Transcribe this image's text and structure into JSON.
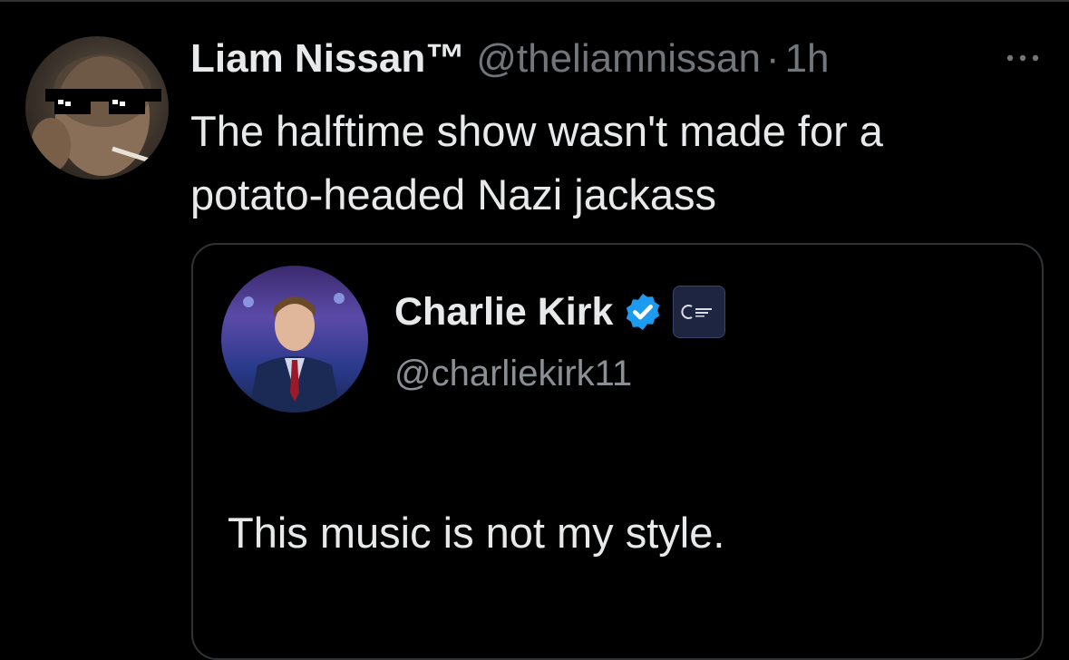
{
  "tweet": {
    "author": {
      "display_name": "Liam Nissan™",
      "handle": "@theliamnissan",
      "separator": "·",
      "timestamp": "1h",
      "avatar_icon": "profile-photo-sunglasses"
    },
    "text": "The halftime show wasn't made for a potato-headed Nazi jackass",
    "more_icon": "more-horizontal-icon"
  },
  "quote": {
    "author": {
      "display_name": "Charlie Kirk",
      "handle": "@charliekirk11",
      "verified_icon": "verified-badge-icon",
      "verified_color": "#1d9bf0",
      "affiliation_icon": "organization-badge-icon"
    },
    "text": "This music is not my style."
  },
  "colors": {
    "background": "#000000",
    "primary_text": "#e7e9ea",
    "secondary_text": "#71767b",
    "border": "#2f3336"
  }
}
